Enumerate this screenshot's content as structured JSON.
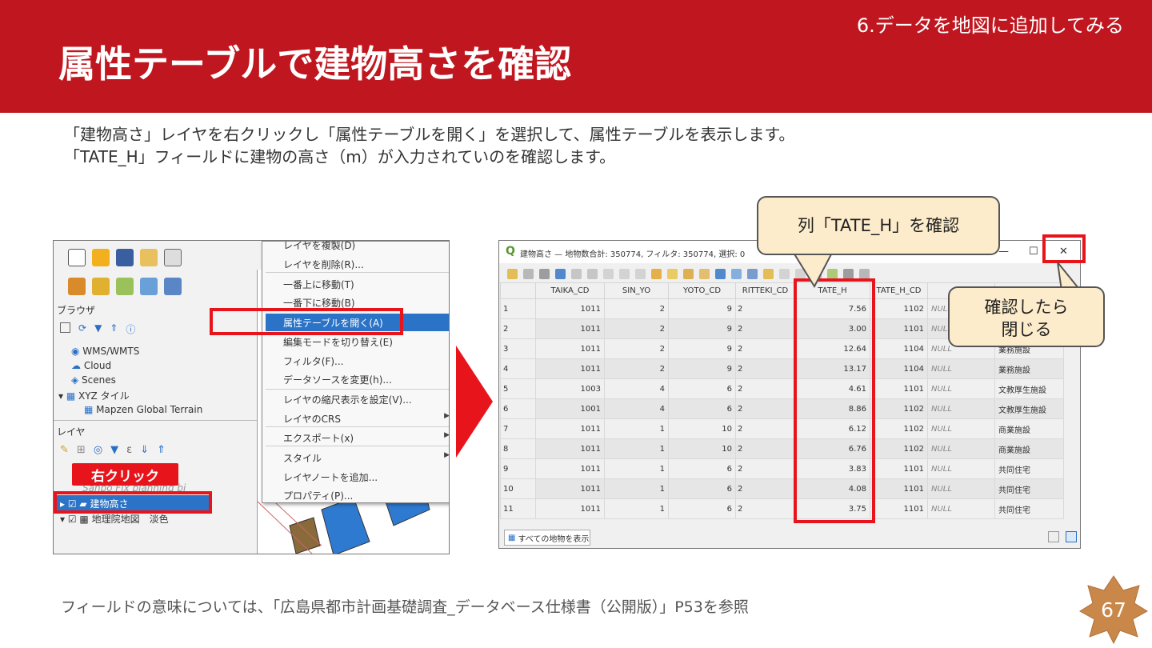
{
  "section_label": "6.データを地図に追加してみる",
  "title": "属性テーブルで建物高さを確認",
  "description": [
    "「建物高さ」レイヤを右クリックし「属性テーブルを開く」を選択して、属性テーブルを表示します。",
    "「TATE_H」フィールドに建物の高さ（m）が入力されていのを確認します。"
  ],
  "footnote": "フィールドの意味については、「広島県都市計画基礎調査_データベース仕様書（公開版）」P53を参照",
  "page_number": "67",
  "qgis_left": {
    "browser_title": "ブラウザ",
    "browser_items": [
      "WMS/WMTS",
      "Cloud",
      "Scenes",
      "XYZ タイル",
      "Mapzen Global Terrain"
    ],
    "layers_title": "レイヤ",
    "layer_items": [
      "建物高さ",
      "地理院地図　淡色"
    ],
    "partial_layer": "Sanbo Fix planning bi",
    "right_click_label": "右クリック",
    "context_menu": [
      "レイヤを複製(D)",
      "レイヤを削除(R)...",
      "一番上に移動(T)",
      "一番下に移動(B)",
      "属性テーブルを開く(A)",
      "編集モードを切り替え(E)",
      "フィルタ(F)...",
      "データソースを変更(h)...",
      "レイヤの縮尺表示を設定(V)...",
      "レイヤのCRS",
      "エクスポート(x)",
      "スタイル",
      "レイヤノートを追加...",
      "プロパティ(P)..."
    ]
  },
  "attr_table": {
    "window_title": "建物高さ — 地物数合計: 350774, フィルタ: 350774, 選択: 0",
    "columns": [
      "TAIKA_CD",
      "SIN_YO",
      "YOTO_CD",
      "RITTEKI_CD",
      "TATE_H",
      "TATE_H_CD",
      "",
      ""
    ],
    "rows": [
      [
        "1",
        "1011",
        "2",
        "9",
        "2",
        "7.56",
        "1102",
        "NULL",
        ""
      ],
      [
        "2",
        "1011",
        "2",
        "9",
        "2",
        "3.00",
        "1101",
        "NULL",
        ""
      ],
      [
        "3",
        "1011",
        "2",
        "9",
        "2",
        "12.64",
        "1104",
        "NULL",
        "業務施設"
      ],
      [
        "4",
        "1011",
        "2",
        "9",
        "2",
        "13.17",
        "1104",
        "NULL",
        "業務施設"
      ],
      [
        "5",
        "1003",
        "4",
        "6",
        "2",
        "4.61",
        "1101",
        "NULL",
        "文教厚生施設"
      ],
      [
        "6",
        "1001",
        "4",
        "6",
        "2",
        "8.86",
        "1102",
        "NULL",
        "文教厚生施設"
      ],
      [
        "7",
        "1011",
        "1",
        "10",
        "2",
        "6.12",
        "1102",
        "NULL",
        "商業施設"
      ],
      [
        "8",
        "1011",
        "1",
        "10",
        "2",
        "6.76",
        "1102",
        "NULL",
        "商業施設"
      ],
      [
        "9",
        "1011",
        "1",
        "6",
        "2",
        "3.83",
        "1101",
        "NULL",
        "共同住宅"
      ],
      [
        "10",
        "1011",
        "1",
        "6",
        "2",
        "4.08",
        "1101",
        "NULL",
        "共同住宅"
      ],
      [
        "11",
        "1011",
        "1",
        "6",
        "2",
        "3.75",
        "1101",
        "NULL",
        "共同住宅"
      ]
    ],
    "show_all_label": "すべての地物を表示",
    "minimize": "—",
    "maximize": "☐",
    "close": "✕"
  },
  "callouts": {
    "check_column": "列「TATE_H」を確認",
    "close_after": [
      "確認したら",
      "閉じる"
    ]
  },
  "colors": {
    "header_red": "#c0161f",
    "highlight_red": "#e8141c",
    "callout_fill": "#fdeccb",
    "selection_blue": "#2a73c6"
  }
}
